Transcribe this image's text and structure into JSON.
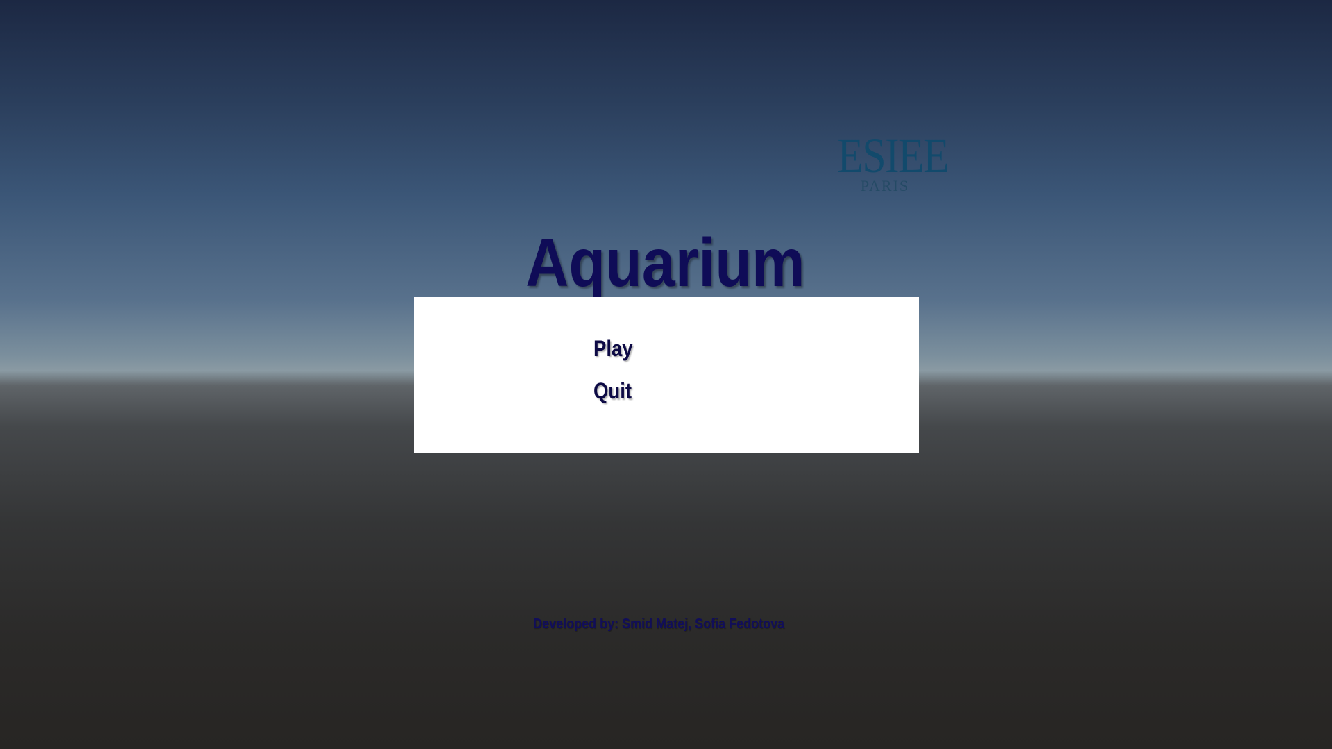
{
  "logo": {
    "main": "ESIEE",
    "sub": "PARIS"
  },
  "title": "Aquarium",
  "menu": {
    "play_label": "Play",
    "quit_label": "Quit"
  },
  "credits": "Developed by: Smid Matej, Sofia Fedotova",
  "colors": {
    "title": "#0f0c57",
    "menu_text": "#0d0a45",
    "panel": "#ffffff",
    "logo": "#0f4a6c",
    "sky_top": "#1c2843",
    "horizon": "#8a9aa3",
    "ground": "#272523"
  }
}
